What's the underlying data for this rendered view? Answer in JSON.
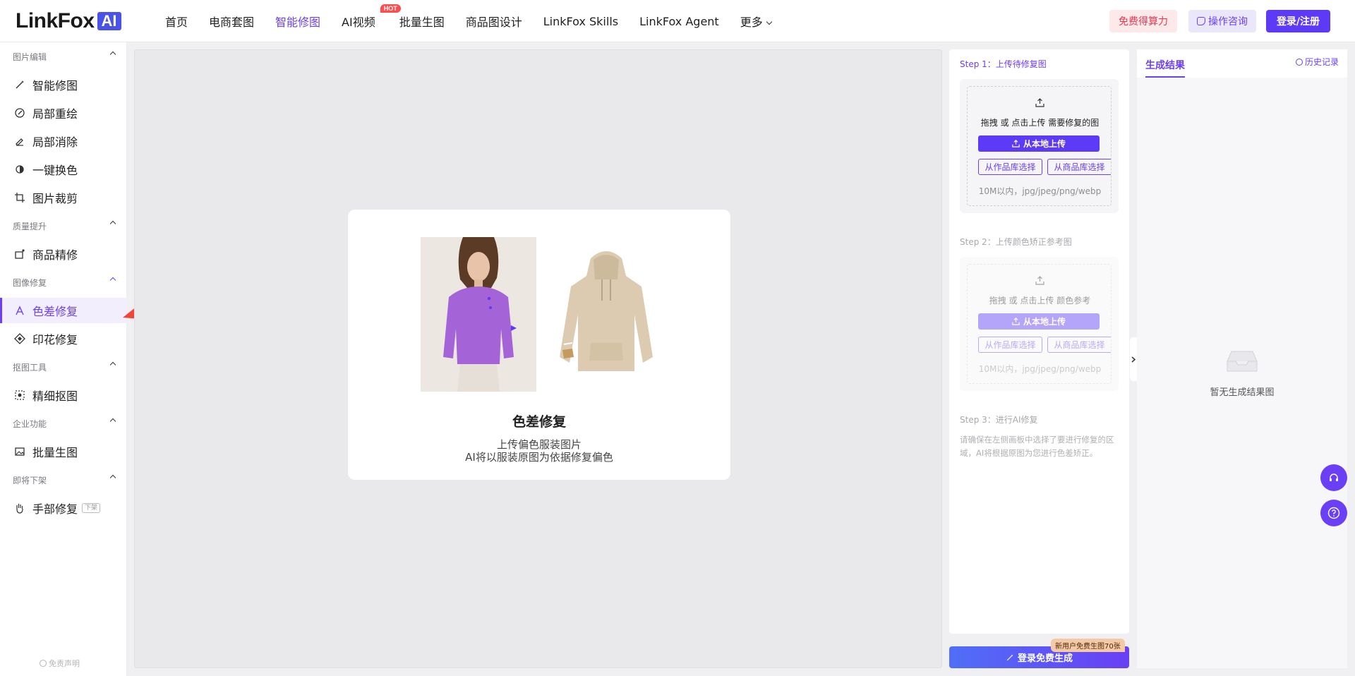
{
  "header": {
    "logo_text": "LinkFox",
    "logo_badge": "AI",
    "nav": [
      {
        "label": "首页"
      },
      {
        "label": "电商套图"
      },
      {
        "label": "智能修图"
      },
      {
        "label": "AI视频",
        "badge": "HOT"
      },
      {
        "label": "批量生图"
      },
      {
        "label": "商品图设计"
      },
      {
        "label": "LinkFox Skills"
      },
      {
        "label": "LinkFox Agent"
      },
      {
        "label": "更多"
      }
    ],
    "free_btn": "免费得算力",
    "consult_btn": "操作咨询",
    "login_btn": "登录/注册"
  },
  "sidebar": {
    "sections": [
      {
        "title": "图片编辑",
        "items": [
          "智能修图",
          "局部重绘",
          "局部消除",
          "一键换色",
          "图片裁剪"
        ]
      },
      {
        "title": "质量提升",
        "items": [
          "商品精修"
        ]
      },
      {
        "title": "图像修复",
        "items": [
          "色差修复",
          "印花修复"
        ]
      },
      {
        "title": "抠图工具",
        "items": [
          "精细抠图"
        ]
      },
      {
        "title": "企业功能",
        "items": [
          "批量生图"
        ]
      },
      {
        "title": "即将下架",
        "items": [
          "手部修复"
        ]
      }
    ],
    "active_item": "色差修复",
    "hand_tag": "下架",
    "disclaimer": "免责声明"
  },
  "card": {
    "title": "色差修复",
    "desc_line1": "上传偏色服装图片",
    "desc_line2": "AI将以服装原图为依据修复偏色"
  },
  "steps": {
    "step1": {
      "label": "Step 1：上传待修复图",
      "hint": "拖拽 或 点击上传 需要修复的图",
      "upload_btn": "从本地上传",
      "lib_btn_a": "从作品库选择",
      "lib_btn_b": "从商品库选择",
      "limit": "10M以内，jpg/jpeg/png/webp"
    },
    "step2": {
      "label": "Step 2：上传颜色矫正参考图",
      "hint": "拖拽 或 点击上传 颜色参考",
      "upload_btn": "从本地上传",
      "lib_btn_a": "从作品库选择",
      "lib_btn_b": "从商品库选择",
      "limit": "10M以内，jpg/jpeg/png/webp"
    },
    "step3": {
      "label": "Step 3：进行AI修复",
      "desc": "请确保在左侧画板中选择了要进行修复的区域，AI将根据原图为您进行色差矫正。"
    },
    "generate_btn": "登录免费生成",
    "promo": "新用户免费生图70张"
  },
  "results": {
    "tab": "生成结果",
    "history": "历史记录",
    "empty_text": "暂无生成结果图"
  },
  "colors": {
    "accent": "#6b3ff5",
    "brand_blue": "#4a53e8",
    "free_red": "#e53950"
  },
  "icons": {
    "headset": "headset-icon",
    "help": "question-circle-icon",
    "upload": "upload-icon",
    "empty": "empty-inbox-icon"
  }
}
